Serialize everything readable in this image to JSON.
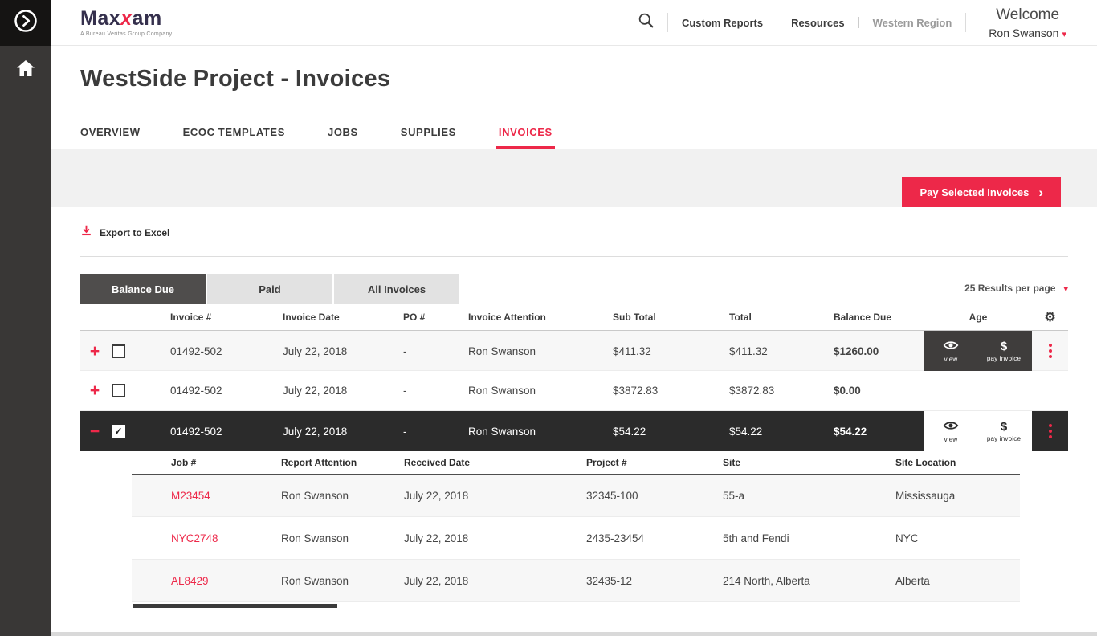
{
  "icons": {
    "caret_down": "▾",
    "chevron_right": "›",
    "check": "✓",
    "gear": "⚙",
    "dollar": "$"
  },
  "header": {
    "logo_part1": "Max",
    "logo_part2": "x",
    "logo_part3": "am",
    "logo_tagline": "A Bureau Veritas Group Company",
    "nav_items": [
      {
        "label": "Custom Reports"
      },
      {
        "label": "Resources"
      },
      {
        "label": "Western Region"
      }
    ],
    "welcome_label": "Welcome",
    "user_name": "Ron Swanson"
  },
  "page": {
    "title": "WestSide Project - Invoices",
    "tabs": [
      {
        "label": "OVERVIEW"
      },
      {
        "label": "ECOC TEMPLATES"
      },
      {
        "label": "JOBS"
      },
      {
        "label": "SUPPLIES"
      },
      {
        "label": "INVOICES"
      }
    ],
    "active_tab": "INVOICES",
    "pay_button_label": "Pay Selected Invoices",
    "export_label": "Export to Excel",
    "filters": [
      {
        "label": "Balance Due"
      },
      {
        "label": "Paid"
      },
      {
        "label": "All Invoices"
      }
    ],
    "results_per_page": "25 Results per page"
  },
  "invoice_table": {
    "columns": [
      "Invoice #",
      "Invoice Date",
      "PO #",
      "Invoice Attention",
      "Sub Total",
      "Total",
      "Balance Due",
      "Age"
    ],
    "action_view": "view",
    "action_pay": "pay invoice",
    "rows": [
      {
        "expand": "+",
        "invoice_number": "01492-502",
        "invoice_date": "July 22, 2018",
        "po_number": "-",
        "attention": "Ron Swanson",
        "sub_total": "$411.32",
        "total": "$411.32",
        "balance_due": "$1260.00"
      },
      {
        "expand": "+",
        "invoice_number": "01492-502",
        "invoice_date": "July 22, 2018",
        "po_number": "-",
        "attention": "Ron Swanson",
        "sub_total": "$3872.83",
        "total": "$3872.83",
        "balance_due": "$0.00"
      },
      {
        "expand": "−",
        "invoice_number": "01492-502",
        "invoice_date": "July 22, 2018",
        "po_number": "-",
        "attention": "Ron Swanson",
        "sub_total": "$54.22",
        "total": "$54.22",
        "balance_due": "$54.22"
      }
    ]
  },
  "job_table": {
    "columns": [
      "Job #",
      "Report Attention",
      "Received Date",
      "Project #",
      "Site",
      "Site Location"
    ],
    "rows": [
      {
        "job_number": "M23454",
        "report_attention": "Ron Swanson",
        "received_date": "July 22, 2018",
        "project_number": "32345-100",
        "site": "55-a",
        "site_location": "Mississauga"
      },
      {
        "job_number": "NYC2748",
        "report_attention": "Ron Swanson",
        "received_date": "July 22, 2018",
        "project_number": "2435-23454",
        "site": "5th and Fendi",
        "site_location": "NYC"
      },
      {
        "job_number": "AL8429",
        "report_attention": "Ron Swanson",
        "received_date": "July 22, 2018",
        "project_number": "32435-12",
        "site": "214 North, Alberta",
        "site_location": "Alberta"
      }
    ]
  }
}
